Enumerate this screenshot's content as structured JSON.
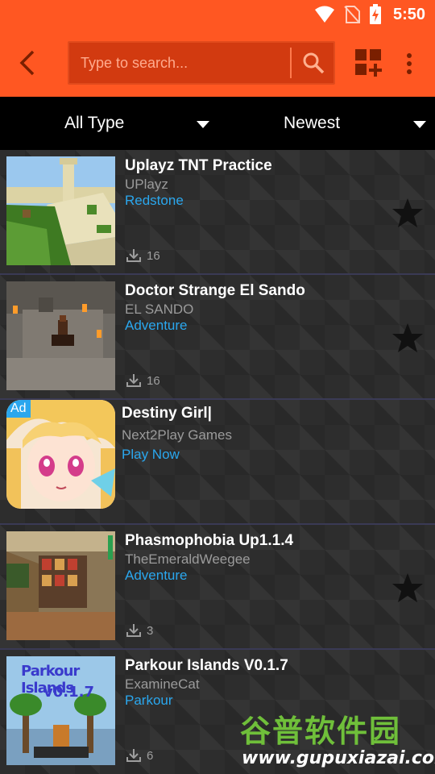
{
  "status_bar": {
    "time": "5:50",
    "icons": [
      "wifi-icon",
      "no-sim-icon",
      "battery-charging-icon"
    ]
  },
  "app_bar": {
    "search_placeholder": "Type to search...",
    "icons": [
      "back-arrow-icon",
      "search-icon",
      "add-grid-icon",
      "more-vert-icon"
    ]
  },
  "filters": {
    "type": "All Type",
    "sort": "Newest"
  },
  "items": [
    {
      "title": "Uplayz TNT Practice",
      "author": "UPlayz",
      "category": "Redstone",
      "downloads": "16"
    },
    {
      "title": "Doctor Strange El Sando",
      "author": "EL SANDO",
      "category": "Adventure",
      "downloads": "16"
    },
    {
      "title": "Destiny Girl|",
      "author": "Next2Play Games",
      "category": "Play Now",
      "ad_label": "Ad"
    },
    {
      "title": "Phasmophobia Up1.1.4",
      "author": "TheEmeraldWeegee",
      "category": "Adventure",
      "downloads": "3"
    },
    {
      "title": "Parkour Islands V0.1.7",
      "author": "ExamineCat",
      "category": "Parkour",
      "downloads": "6",
      "thumb_text": [
        "Parkour Islands",
        "v0.1.7"
      ]
    }
  ],
  "watermark": {
    "cn": "谷普软件园",
    "en": "www.gupuxiazai.com"
  },
  "colors": {
    "accent": "#ff5722",
    "link": "#2aa7ee"
  }
}
